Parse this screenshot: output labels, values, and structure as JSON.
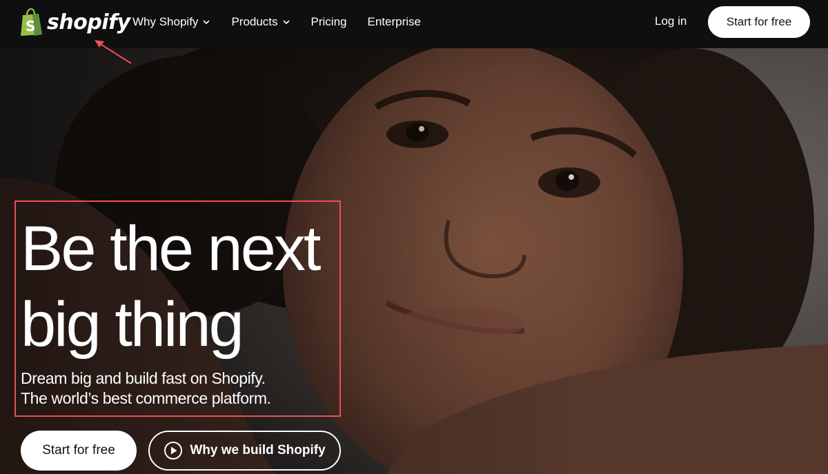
{
  "brand": {
    "name": "shopify",
    "logo_color": "#95bf47"
  },
  "nav": {
    "links": [
      {
        "label": "Why Shopify",
        "has_dropdown": true
      },
      {
        "label": "Products",
        "has_dropdown": true
      },
      {
        "label": "Pricing",
        "has_dropdown": false
      },
      {
        "label": "Enterprise",
        "has_dropdown": false
      }
    ],
    "login_label": "Log in",
    "cta_label": "Start for free"
  },
  "hero": {
    "headline_line1": "Be the next",
    "headline_line2": "big thing",
    "subline_line1": "Dream big and build fast on Shopify.",
    "subline_line2": "The world’s best commerce platform.",
    "primary_button": "Start for free",
    "secondary_button": "Why we build Shopify"
  },
  "annotation": {
    "color": "#ef4e55"
  }
}
